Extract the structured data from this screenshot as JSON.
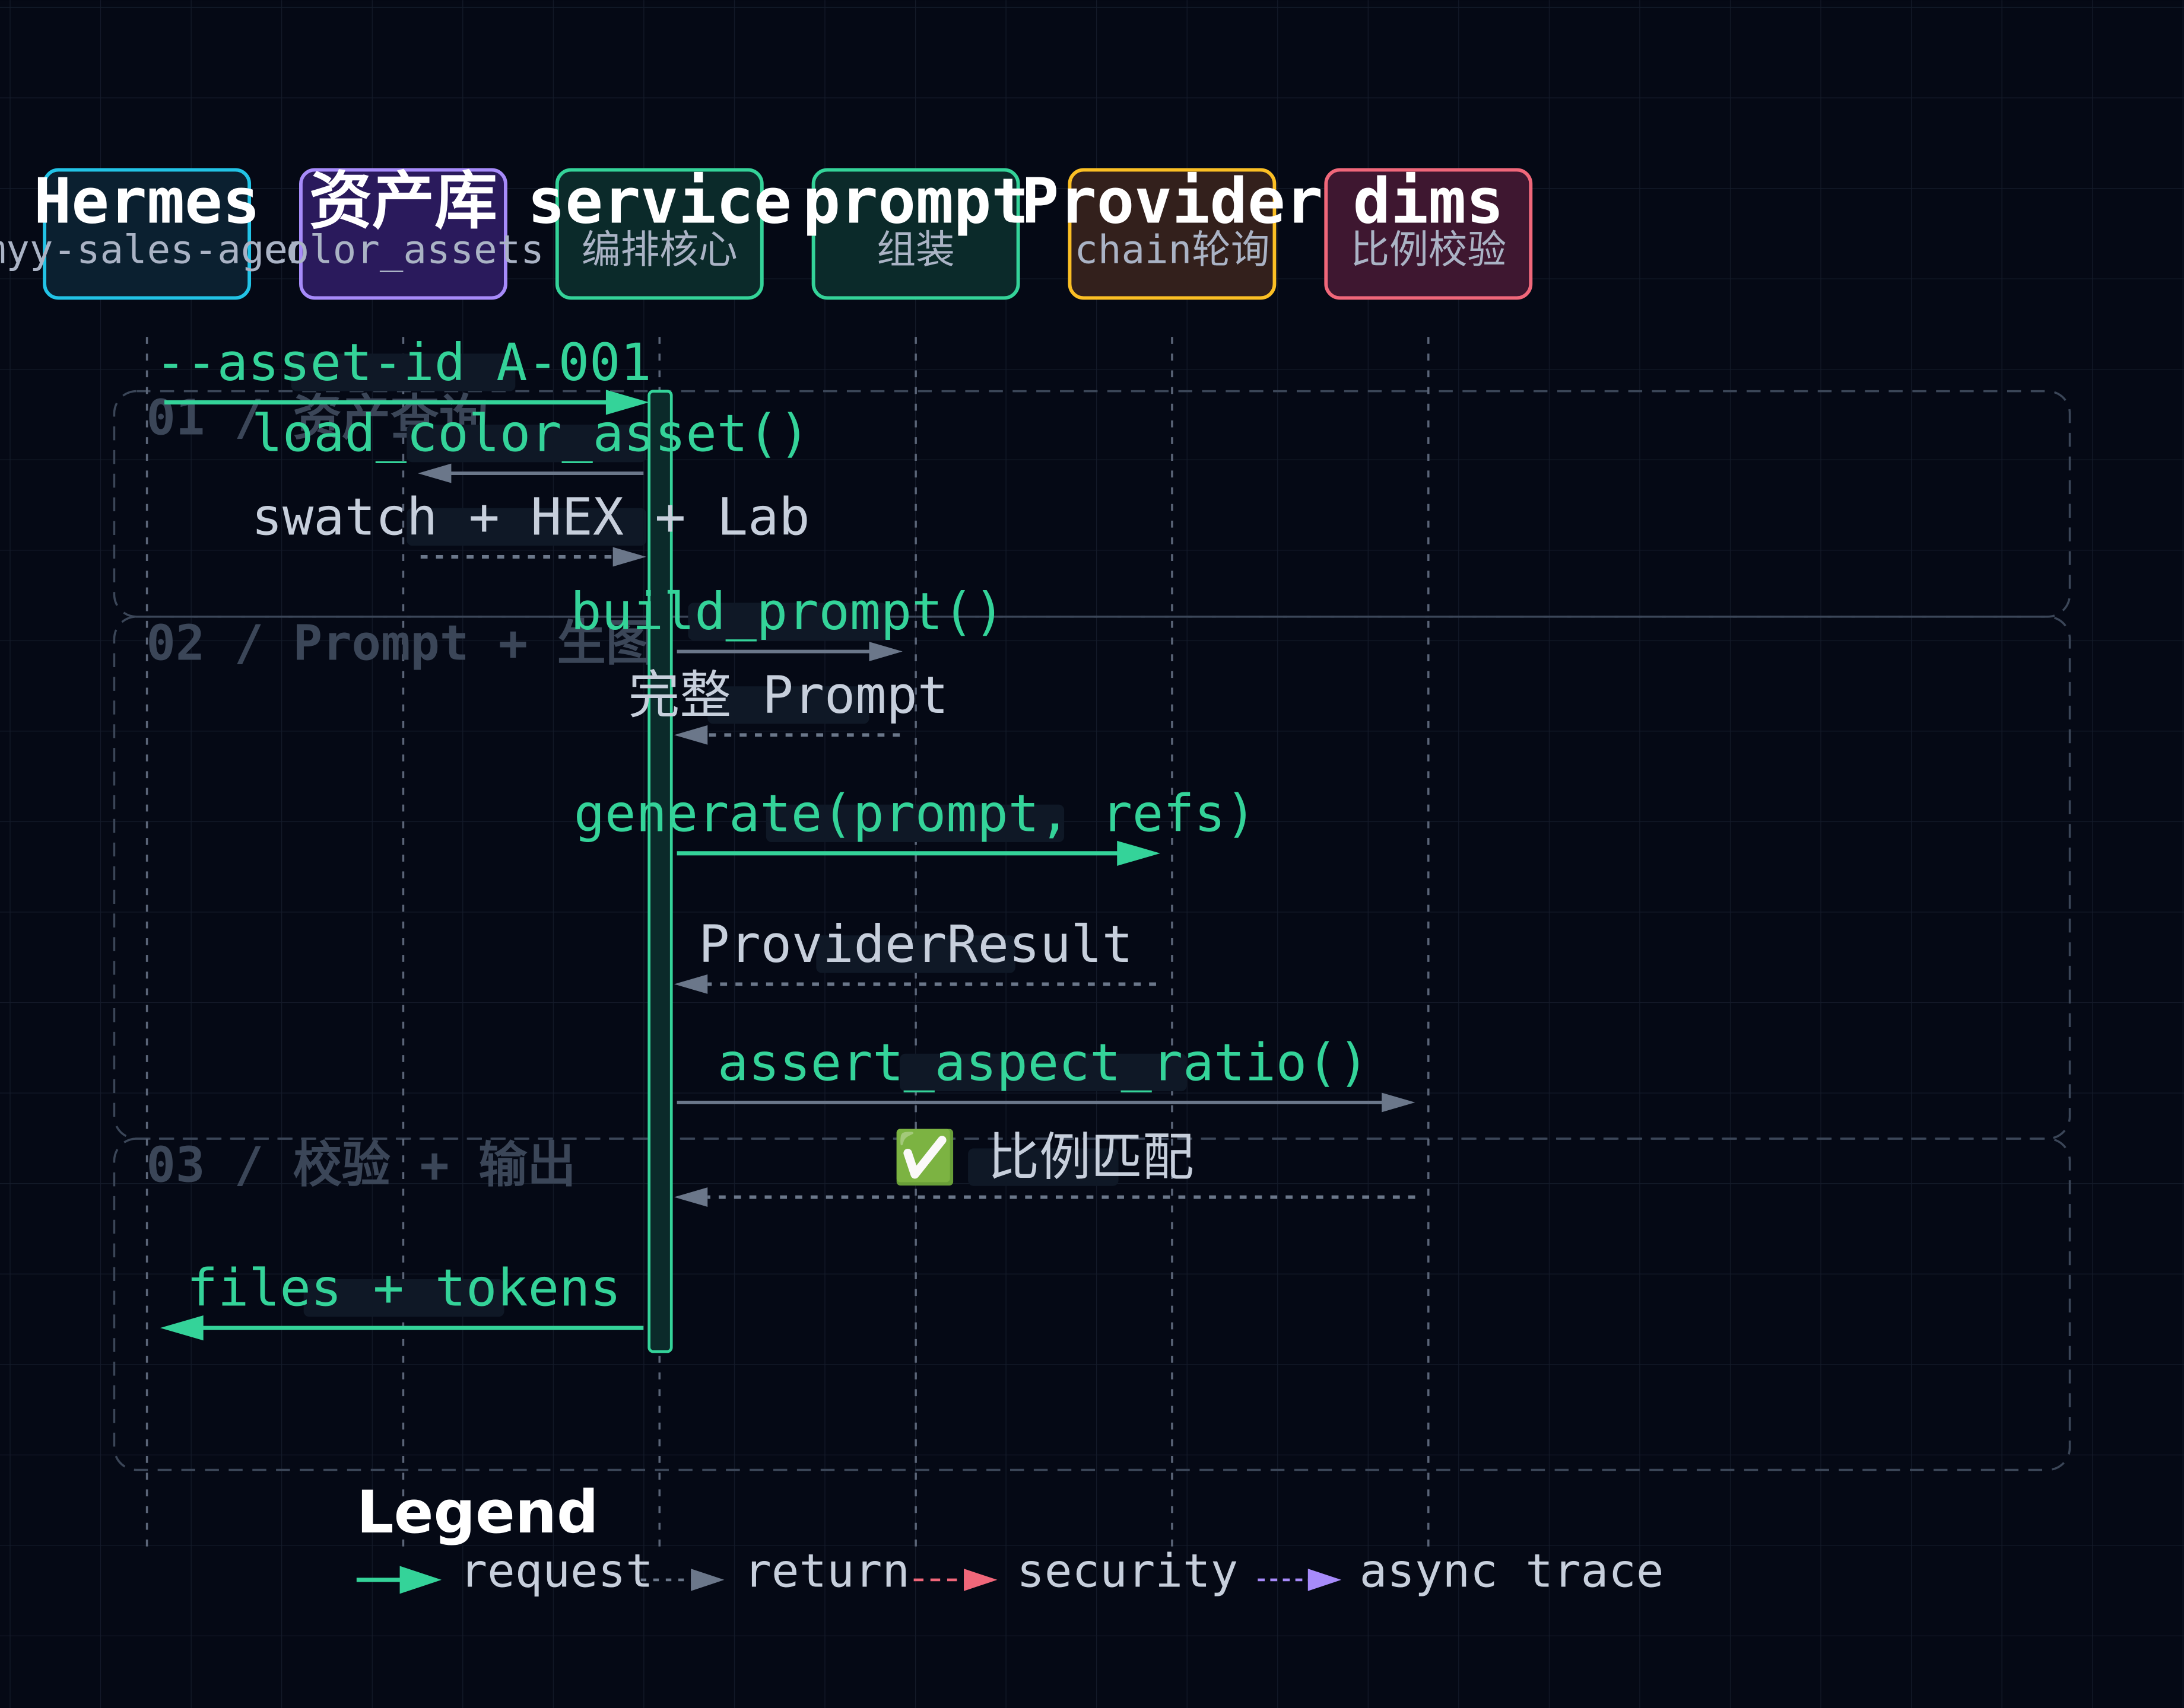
{
  "actors": [
    {
      "id": "hermes",
      "title": "Hermes",
      "subtitle": "ymyy-sales-agent",
      "border": "#22c3e6",
      "fill": "#0b2030"
    },
    {
      "id": "assets",
      "title": "资产库",
      "subtitle": "color_assets",
      "border": "#a78bfa",
      "fill": "#2a1a5c"
    },
    {
      "id": "service",
      "title": "service",
      "subtitle": "编排核心",
      "border": "#34d399",
      "fill": "#0b2a2a"
    },
    {
      "id": "prompt",
      "title": "prompt",
      "subtitle": "组装",
      "border": "#34d399",
      "fill": "#0b2a2a"
    },
    {
      "id": "provider",
      "title": "Provider",
      "subtitle": "chain轮询",
      "border": "#fbbf24",
      "fill": "#33201c"
    },
    {
      "id": "dims",
      "title": "dims",
      "subtitle": "比例校验",
      "border": "#f0677a",
      "fill": "#3e1730"
    }
  ],
  "phases": [
    {
      "label": "01 / 资产查询"
    },
    {
      "label": "02 / Prompt + 生图"
    },
    {
      "label": "03 / 校验 + 输出"
    }
  ],
  "messages": [
    {
      "label": "--asset-id A-001",
      "from": "hermes",
      "to": "service",
      "kind": "request"
    },
    {
      "label": "load_color_asset()",
      "from": "service",
      "to": "assets",
      "kind": "call"
    },
    {
      "label": "swatch + HEX + Lab",
      "from": "assets",
      "to": "service",
      "kind": "return"
    },
    {
      "label": "build_prompt()",
      "from": "service",
      "to": "prompt",
      "kind": "call"
    },
    {
      "label": "完整 Prompt",
      "from": "prompt",
      "to": "service",
      "kind": "return"
    },
    {
      "label": "generate(prompt, refs)",
      "from": "service",
      "to": "provider",
      "kind": "request"
    },
    {
      "label": "ProviderResult",
      "from": "provider",
      "to": "service",
      "kind": "return"
    },
    {
      "label": "assert_aspect_ratio()",
      "from": "service",
      "to": "dims",
      "kind": "call"
    },
    {
      "label": "✅ 比例匹配",
      "from": "dims",
      "to": "service",
      "kind": "return"
    },
    {
      "label": "files + tokens",
      "from": "service",
      "to": "hermes",
      "kind": "request"
    }
  ],
  "legend": {
    "title": "Legend",
    "items": [
      {
        "label": "request",
        "kind": "request"
      },
      {
        "label": "return",
        "kind": "return"
      },
      {
        "label": "security",
        "kind": "security"
      },
      {
        "label": "async trace",
        "kind": "async"
      }
    ]
  },
  "colors": {
    "background": "#050915",
    "grid": "#151c2b",
    "request": "#34d399",
    "return": "#6b778a",
    "security": "#f0677a",
    "async": "#a78bfa",
    "label_bg": "#0f1826",
    "phase_border": "#3b4658"
  }
}
